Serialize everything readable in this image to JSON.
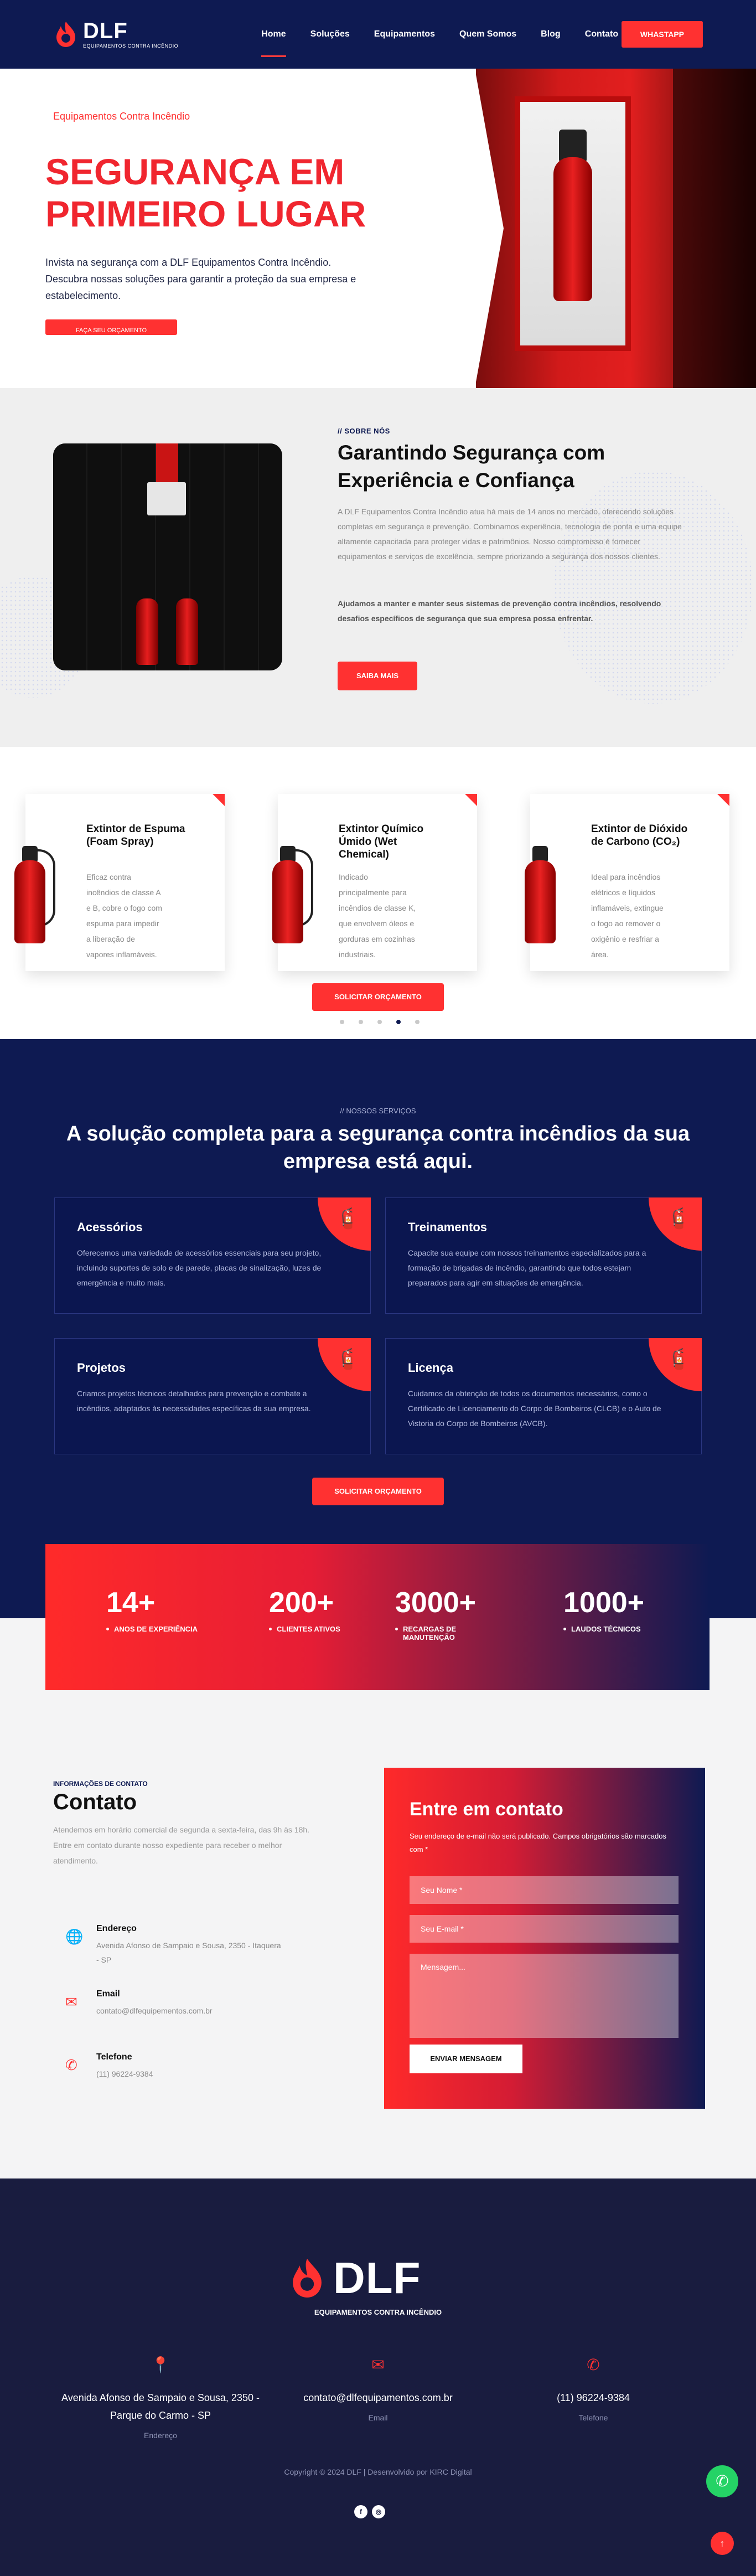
{
  "brand": {
    "name": "DLF",
    "tagline": "EQUIPAMENTOS CONTRA INCÊNDIO",
    "red": "#ff3131",
    "navy": "#0e1a52"
  },
  "nav": {
    "items": [
      {
        "label": "Home"
      },
      {
        "label": "Soluções"
      },
      {
        "label": "Equipamentos"
      },
      {
        "label": "Quem Somos"
      },
      {
        "label": "Blog"
      },
      {
        "label": "Contato"
      }
    ],
    "cta": "WHASTAPP"
  },
  "hero": {
    "tag": "Equipamentos Contra Incêndio",
    "title": "SEGURANÇA EM PRIMEIRO LUGAR",
    "text": "Invista na segurança com a DLF Equipamentos Contra Incêndio. Descubra nossas soluções para garantir a proteção da sua empresa e estabelecimento.",
    "button": "FAÇA SEU ORÇAMENTO"
  },
  "about": {
    "kicker": "// SOBRE NÓS",
    "title": "Garantindo Segurança com Experiência e Confiança",
    "p1": "A DLF Equipamentos Contra Incêndio atua há mais de 14 anos no mercado, oferecendo soluções completas em segurança e prevenção. Combinamos experiência, tecnologia de ponta e uma equipe altamente capacitada para proteger vidas e patrimônios. Nosso compromisso é fornecer equipamentos e serviços de excelência, sempre priorizando a segurança dos nossos clientes.",
    "p2": "Ajudamos a manter e manter seus sistemas de prevenção contra incêndios, resolvendo desafios específicos de segurança que sua empresa possa enfrentar.",
    "button": "SAIBA MAIS"
  },
  "products": {
    "items": [
      {
        "name": "Extintor de Espuma (Foam Spray)",
        "desc": "Eficaz contra incêndios de classe A e B, cobre o fogo com espuma para impedir a liberação de vapores inflamáveis."
      },
      {
        "name": "Extintor Químico Úmido (Wet Chemical)",
        "desc": "Indicado principalmente para incêndios de classe K, que envolvem óleos e gorduras em cozinhas industriais."
      },
      {
        "name": "Extintor de Dióxido de Carbono (CO₂)",
        "desc": "Ideal para incêndios elétricos e líquidos inflamáveis, extingue o fogo ao remover o oxigênio e resfriar a área."
      }
    ],
    "button": "SOLICITAR ORÇAMENTO",
    "dots": 5,
    "active_dot": 4
  },
  "services": {
    "kicker": "// NOSSOS SERVIÇOS",
    "title": "A solução completa para a segurança contra incêndios da sua empresa está aqui.",
    "items": [
      {
        "name": "Acessórios",
        "desc": "Oferecemos uma variedade de acessórios essenciais para seu projeto, incluindo suportes de solo e de parede, placas de sinalização, luzes de emergência e muito mais."
      },
      {
        "name": "Treinamentos",
        "desc": "Capacite sua equipe com nossos treinamentos especializados para a formação de brigadas de incêndio, garantindo que todos estejam preparados para agir em situações de emergência."
      },
      {
        "name": "Projetos",
        "desc": "Criamos projetos técnicos detalhados para prevenção e combate a incêndios, adaptados às necessidades específicas da sua empresa."
      },
      {
        "name": "Licença",
        "desc": "Cuidamos da obtenção de todos os documentos necessários, como o Certificado de Licenciamento do Corpo de Bombeiros (CLCB) e o Auto de Vistoria do Corpo de Bombeiros (AVCB)."
      }
    ],
    "button": "SOLICITAR ORÇAMENTO"
  },
  "stats": [
    {
      "num": "14+",
      "label": "ANOS DE EXPERIÊNCIA"
    },
    {
      "num": "200+",
      "label": "CLIENTES ATIVOS"
    },
    {
      "num": "3000+",
      "label": "RECARGAS DE MANUTENÇÃO"
    },
    {
      "num": "1000+",
      "label": "LAUDOS TÉCNICOS"
    }
  ],
  "contact": {
    "kicker": "INFORMAÇÕES DE CONTATO",
    "title": "Contato",
    "desc": "Atendemos em horário comercial de segunda a sexta-feira, das 9h às 18h. Entre em contato durante nosso expediente para receber o melhor atendimento.",
    "address": {
      "label": "Endereço",
      "value": "Avenida Afonso de Sampaio e Sousa, 2350 - Itaquera - SP"
    },
    "email": {
      "label": "Email",
      "value": "contato@dlfequipementos.com.br"
    },
    "phone": {
      "label": "Telefone",
      "value": "(11) 96224-9384"
    }
  },
  "form": {
    "title": "Entre em contato",
    "note": "Seu endereço de e-mail não será publicado. Campos obrigatórios são marcados com *",
    "name_placeholder": "Seu Nome *",
    "email_placeholder": "Seu E-mail *",
    "message_placeholder": "Mensagem...",
    "button": "ENVIAR MENSAGEM"
  },
  "footer": {
    "address": {
      "value": "Avenida Afonso de Sampaio e Sousa, 2350 - Parque do Carmo - SP",
      "label": "Endereço"
    },
    "email": {
      "value": "contato@dlfequipamentos.com.br",
      "label": "Email"
    },
    "phone": {
      "value": "(11) 96224-9384",
      "label": "Telefone"
    },
    "copyright": "Copyright © 2024 DLF | Desenvolvido por KIRC Digital"
  }
}
